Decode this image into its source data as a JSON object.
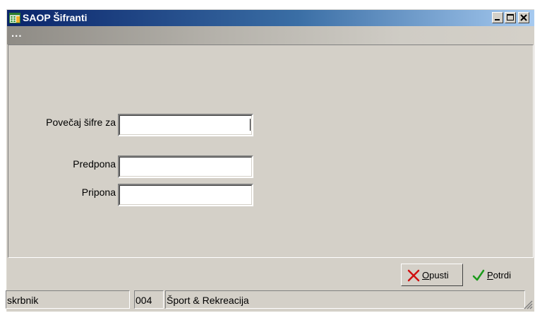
{
  "window": {
    "title": "SAOP Šifranti",
    "subheader": "..."
  },
  "form": {
    "increase_label": "Povečaj šifre za",
    "increase_value": "",
    "prefix_label": "Predpona",
    "prefix_value": "",
    "suffix_label": "Pripona",
    "suffix_value": ""
  },
  "buttons": {
    "cancel_mnemonic": "O",
    "cancel_rest": "pusti",
    "confirm_mnemonic": "P",
    "confirm_rest": "otrdi"
  },
  "status": {
    "user": "skrbnik",
    "code": "004",
    "org": "Šport & Rekreacija"
  },
  "icons": {
    "app": "table-icon",
    "minimize": "minimize-icon",
    "maximize": "maximize-icon",
    "close": "close-icon",
    "cancel": "red-x-icon",
    "confirm": "green-check-icon",
    "grip": "resize-grip-icon"
  }
}
